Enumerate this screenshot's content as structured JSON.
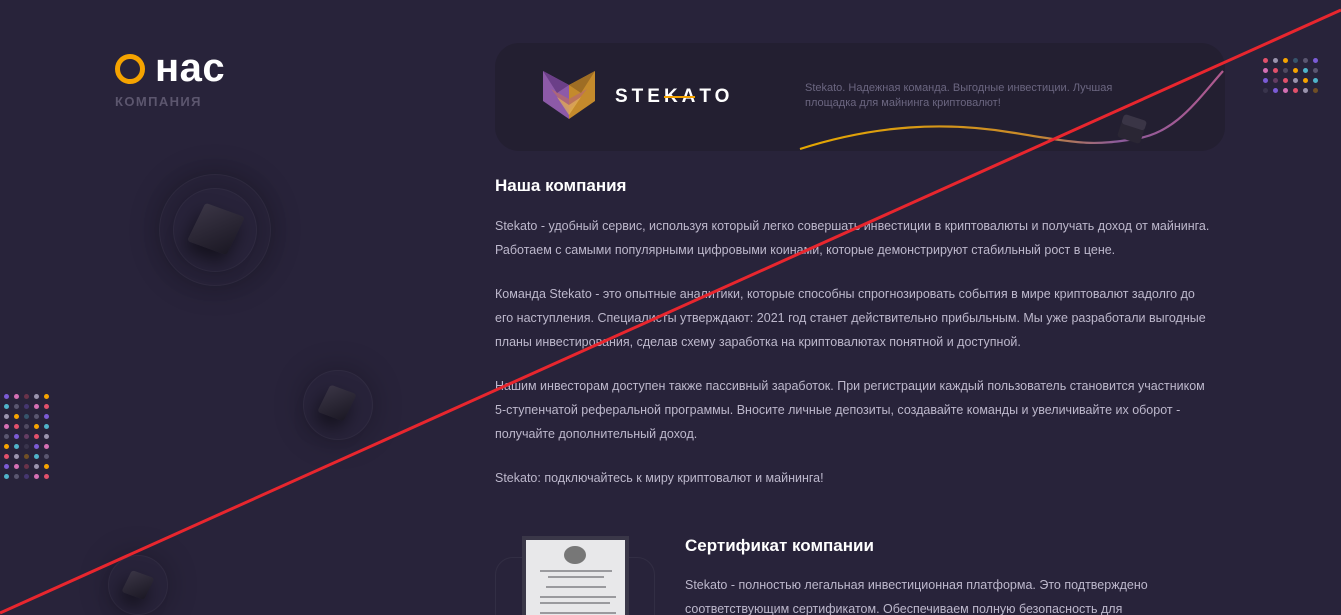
{
  "heading": {
    "title": "нас",
    "subtitle": "КОМПАНИЯ"
  },
  "banner": {
    "brand": "STEKATO",
    "tagline": "Stekato. Надежная команда. Выгодные инвестиции. Лучшая площадка для майнинга криптовалют!"
  },
  "about": {
    "title": "Наша компания",
    "paragraphs": [
      "Stekato - удобный сервис, используя который легко совершать инвестиции в криптовалюты и получать доход от майнинга. Работаем с самыми популярными цифровыми коинами, которые демонстрируют стабильный рост в цене.",
      "Команда Stekato - это опытные аналитики, которые способны спрогнозировать события в мире криптовалют задолго до его наступления. Специалисты утверждают: 2021 год станет действительно прибыльным. Мы уже разработали выгодные планы инвестирования, сделав схему заработка на криптовалютах понятной и доступной.",
      "Нашим инвесторам доступен также пассивный заработок. При регистрации каждый пользователь становится участником 5-ступенчатой реферальной программы. Вносите личные депозиты, создавайте команды и увеличивайте их оборот - получайте дополнительный доход.",
      "Stekato: подключайтесь к миру криптовалют и майнинга!"
    ]
  },
  "certificate": {
    "title": "Сертификат компании",
    "text": "Stekato - полностью легальная инвестиционная платформа. Это подтверждено соответствующим сертификатом. Обеспечиваем полную безопасность для"
  },
  "colors": {
    "background": "#28233a",
    "accent": "#f5a300",
    "strike": "#e8262e"
  }
}
